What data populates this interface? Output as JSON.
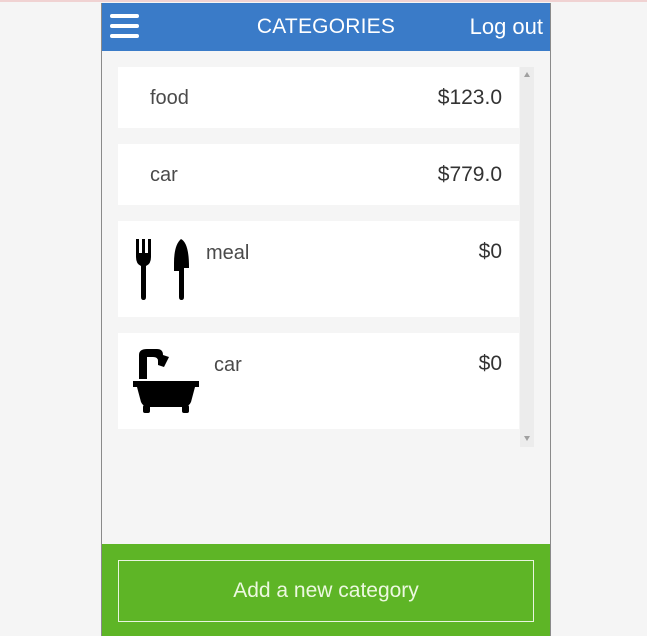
{
  "header": {
    "title": "CATEGORIES",
    "logout_label": "Log out",
    "menu_icon": "hamburger-menu-icon"
  },
  "categories": [
    {
      "name": "food",
      "amount": "$123.0"
    },
    {
      "name": "car",
      "amount": "$779.0"
    },
    {
      "name": "meal",
      "amount": "$0",
      "icon": "cutlery-icon"
    },
    {
      "name": "car",
      "amount": "$0",
      "icon": "bathtub-icon"
    }
  ],
  "footer": {
    "add_label": "Add a new category"
  },
  "colors": {
    "header": "#3a7bc8",
    "footer": "#5eb526",
    "background": "#f5f5f5"
  }
}
